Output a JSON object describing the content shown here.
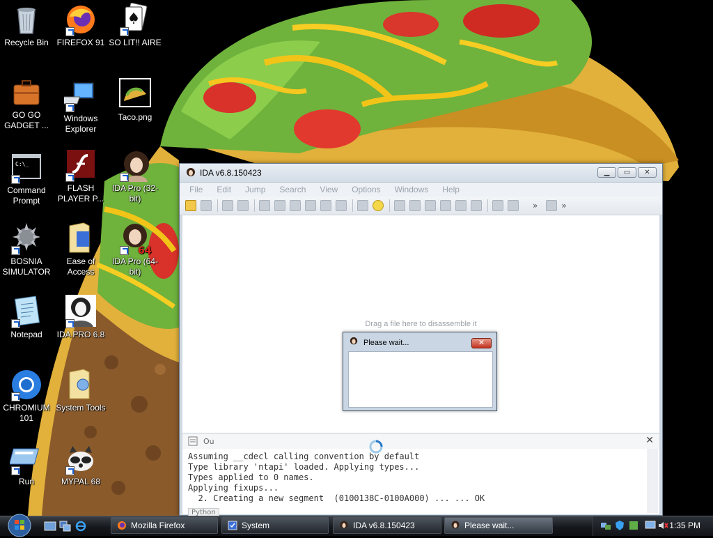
{
  "desktop": {
    "icons": [
      {
        "id": "recycle",
        "label": "Recycle Bin",
        "icon": "recycle-bin-icon"
      },
      {
        "id": "firefox",
        "label": "FIREFOX 91",
        "icon": "firefox-icon"
      },
      {
        "id": "solitaire",
        "label": "SO LIT!! AIRE",
        "icon": "playing-card-icon"
      },
      {
        "id": "gogo",
        "label": "GO GO GADGET ...",
        "icon": "briefcase-icon"
      },
      {
        "id": "explorer",
        "label": "Windows Explorer",
        "icon": "computer-icon"
      },
      {
        "id": "taco",
        "label": "Taco.png",
        "icon": "taco-image-icon"
      },
      {
        "id": "cmd",
        "label": "Command Prompt",
        "icon": "terminal-icon"
      },
      {
        "id": "flash",
        "label": "FLASH PLAYER P...",
        "icon": "flash-icon"
      },
      {
        "id": "ida32",
        "label": "IDA Pro (32-bit)",
        "icon": "ida-portrait-icon"
      },
      {
        "id": "bosnia",
        "label": "BOSNIA SIMULATOR",
        "icon": "spiked-ball-icon"
      },
      {
        "id": "ease",
        "label": "Ease of Access",
        "icon": "folder-icon"
      },
      {
        "id": "ida64",
        "label": "IDA Pro (64-bit)",
        "icon": "ida-portrait-64-icon"
      },
      {
        "id": "notepad",
        "label": "Notepad",
        "icon": "notepad-icon"
      },
      {
        "id": "ida68",
        "label": "IDA PRO 6.8",
        "icon": "ida-sketch-icon"
      },
      {
        "id": "chromium",
        "label": "CHROMIUM 101",
        "icon": "chromium-icon"
      },
      {
        "id": "systools",
        "label": "System Tools",
        "icon": "folder-icon"
      },
      {
        "id": "run",
        "label": "Run",
        "icon": "run-icon"
      },
      {
        "id": "mypal",
        "label": "MYPAL 68",
        "icon": "raccoon-icon"
      }
    ]
  },
  "ida": {
    "title": "IDA v6.8.150423",
    "menu": [
      "File",
      "Edit",
      "Jump",
      "Search",
      "View",
      "Options",
      "Windows",
      "Help"
    ],
    "drop_hint": "Drag a file here to disassemble it",
    "output": {
      "tab_label": "Ou",
      "lines": [
        "Assuming __cdecl calling convention by default",
        "Type library 'ntapi' loaded. Applying types...",
        "Types applied to 0 names.",
        "Applying fixups...",
        "  2. Creating a new segment  (0100138C-0100A000) ... ... OK"
      ],
      "python_tab": "Python"
    }
  },
  "wait_dialog": {
    "title": "Please wait...",
    "close": "✕"
  },
  "taskbar": {
    "tasks": [
      {
        "label": "Mozilla Firefox",
        "icon": "firefox-icon"
      },
      {
        "label": "System",
        "icon": "system-icon"
      },
      {
        "label": "IDA v6.8.150423",
        "icon": "ida-portrait-icon"
      },
      {
        "label": "Please wait...",
        "icon": "ida-portrait-icon"
      }
    ],
    "clock": "1:35 PM"
  }
}
